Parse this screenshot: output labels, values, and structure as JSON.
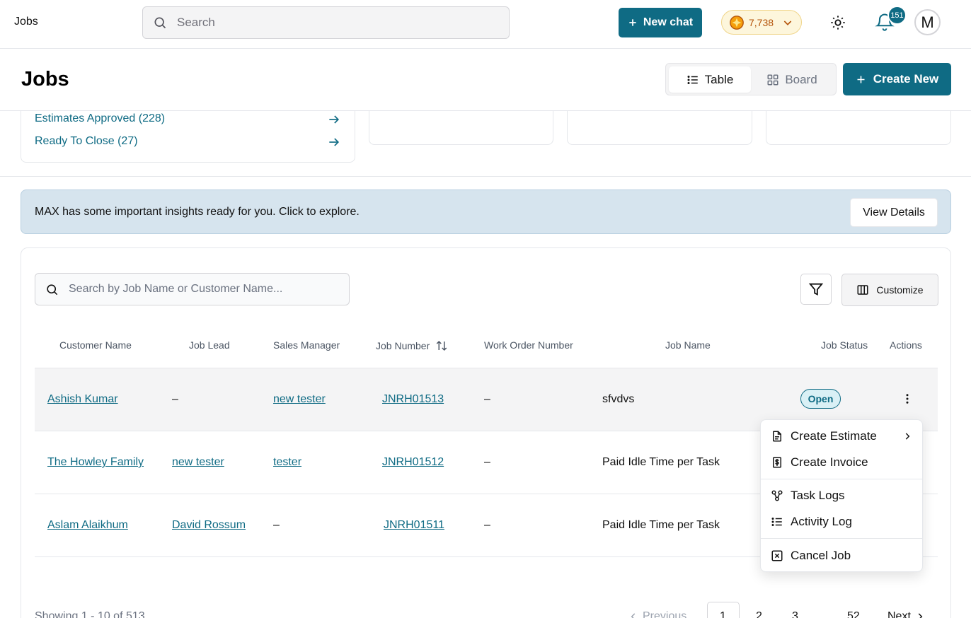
{
  "app": {
    "title": "Jobs"
  },
  "topbar": {
    "search_placeholder": "Search",
    "new_chat_label": "New chat",
    "credits": "7,738",
    "notification_count": "151",
    "avatar_initial": "M"
  },
  "page": {
    "title": "Jobs",
    "view_table_label": "Table",
    "view_board_label": "Board",
    "active_view": "Table",
    "create_new_label": "Create New"
  },
  "summary": {
    "links": [
      {
        "label": "Estimates Approved (228)"
      },
      {
        "label": "Ready To Close (27)"
      }
    ]
  },
  "banner": {
    "text": "MAX has some important insights ready for you. Click to explore.",
    "button_label": "View Details"
  },
  "table": {
    "search_placeholder": "Search by Job Name or Customer Name...",
    "customize_label": "Customize",
    "columns": [
      "Customer Name",
      "Job Lead",
      "Sales Manager",
      "Job Number",
      "Work Order Number",
      "Job Name",
      "Job Status",
      "Actions"
    ],
    "rows": [
      {
        "customer": "Ashish Kumar",
        "job_lead": "–",
        "sales_manager": "new tester",
        "job_number": "JNRH01513",
        "work_order": "–",
        "job_name": "sfvdvs",
        "status": "Open"
      },
      {
        "customer": "The Howley Family",
        "job_lead": "new tester",
        "sales_manager": "tester",
        "job_number": "JNRH01512",
        "work_order": "–",
        "job_name": "Paid Idle Time per Task",
        "status": ""
      },
      {
        "customer": "Aslam Alaikhum",
        "job_lead": "David Rossum",
        "sales_manager": "–",
        "job_number": "JNRH01511",
        "work_order": "–",
        "job_name": "Paid Idle Time per Task",
        "status": ""
      }
    ]
  },
  "pagination": {
    "info": "Showing 1 - 10 of 513",
    "previous_label": "Previous",
    "pages": [
      "1",
      "2",
      "3",
      "...",
      "52"
    ],
    "current_page": "1",
    "next_label": "Next"
  },
  "action_menu": {
    "items": [
      {
        "label": "Create Estimate",
        "icon": "file-text-icon",
        "has_submenu": true
      },
      {
        "label": "Create Invoice",
        "icon": "invoice-dollar-icon"
      },
      {
        "label": "Task Logs",
        "icon": "network-icon"
      },
      {
        "label": "Activity Log",
        "icon": "list-icon"
      },
      {
        "label": "Cancel Job",
        "icon": "x-square-icon"
      }
    ]
  },
  "colors": {
    "brand": "#0f6b84",
    "banner_bg": "#d6e4ee",
    "credits_text": "#b45309",
    "row_highlight": "#f4f4f5"
  }
}
